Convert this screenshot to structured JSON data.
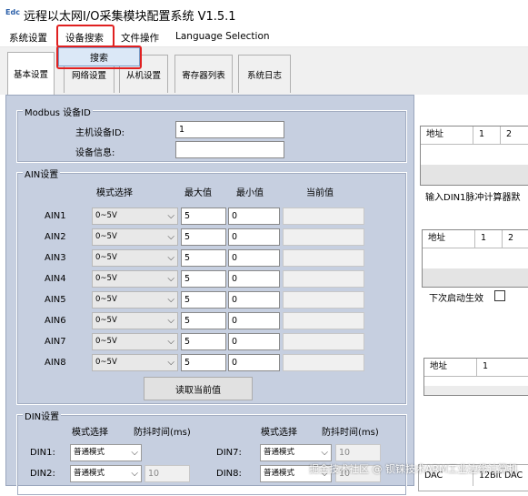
{
  "window": {
    "icon": "Edc",
    "title": "远程以太网I/O采集模块配置系统 V1.5.1"
  },
  "menu": [
    "系统设置",
    "设备搜索",
    "文件操作",
    "Language Selection"
  ],
  "dropdown": {
    "item": "搜索"
  },
  "tabs": [
    "基本设置",
    "网络设置",
    "从机设置",
    "寄存器列表",
    "系统日志"
  ],
  "modbus": {
    "legend": "Modbus 设备ID",
    "id_label": "主机设备ID:",
    "id_value": "1",
    "info_label": "设备信息:",
    "info_value": ""
  },
  "ain": {
    "legend": "AIN设置",
    "headers": {
      "mode": "模式选择",
      "max": "最大值",
      "min": "最小值",
      "cur": "当前值"
    },
    "rows": [
      {
        "name": "AIN1",
        "mode": "0~5V",
        "max": "5",
        "min": "0"
      },
      {
        "name": "AIN2",
        "mode": "0~5V",
        "max": "5",
        "min": "0"
      },
      {
        "name": "AIN3",
        "mode": "0~5V",
        "max": "5",
        "min": "0"
      },
      {
        "name": "AIN4",
        "mode": "0~5V",
        "max": "5",
        "min": "0"
      },
      {
        "name": "AIN5",
        "mode": "0~5V",
        "max": "5",
        "min": "0"
      },
      {
        "name": "AIN6",
        "mode": "0~5V",
        "max": "5",
        "min": "0"
      },
      {
        "name": "AIN7",
        "mode": "0~5V",
        "max": "5",
        "min": "0"
      },
      {
        "name": "AIN8",
        "mode": "0~5V",
        "max": "5",
        "min": "0"
      }
    ],
    "read_button": "读取当前值"
  },
  "din": {
    "legend": "DIN设置",
    "mode_header": "模式选择",
    "debounce_header": "防抖时间(ms)",
    "rows": [
      {
        "name": "DIN1:",
        "mode": "普通模式",
        "debounce": ""
      },
      {
        "name": "DIN2:",
        "mode": "普通模式",
        "debounce": "10"
      },
      {
        "name": "DIN7:",
        "mode": "普通模式",
        "debounce": "10"
      },
      {
        "name": "DIN8:",
        "mode": "普通模式",
        "debounce": "10"
      }
    ]
  },
  "right": {
    "grid1": {
      "headers": [
        "地址",
        "1",
        "2"
      ]
    },
    "grid1_caption": "输入DIN1脉冲计算器默",
    "grid2": {
      "headers": [
        "地址",
        "1",
        "2"
      ]
    },
    "next_boot_label": "下次启动生效",
    "grid3": {
      "headers": [
        "地址",
        "1"
      ]
    },
    "dac_headers": [
      "DAC",
      "12Bit DAC"
    ]
  },
  "watermark": "掘金技术社区 @ 钡铼技术ARM工业边缘计算机"
}
